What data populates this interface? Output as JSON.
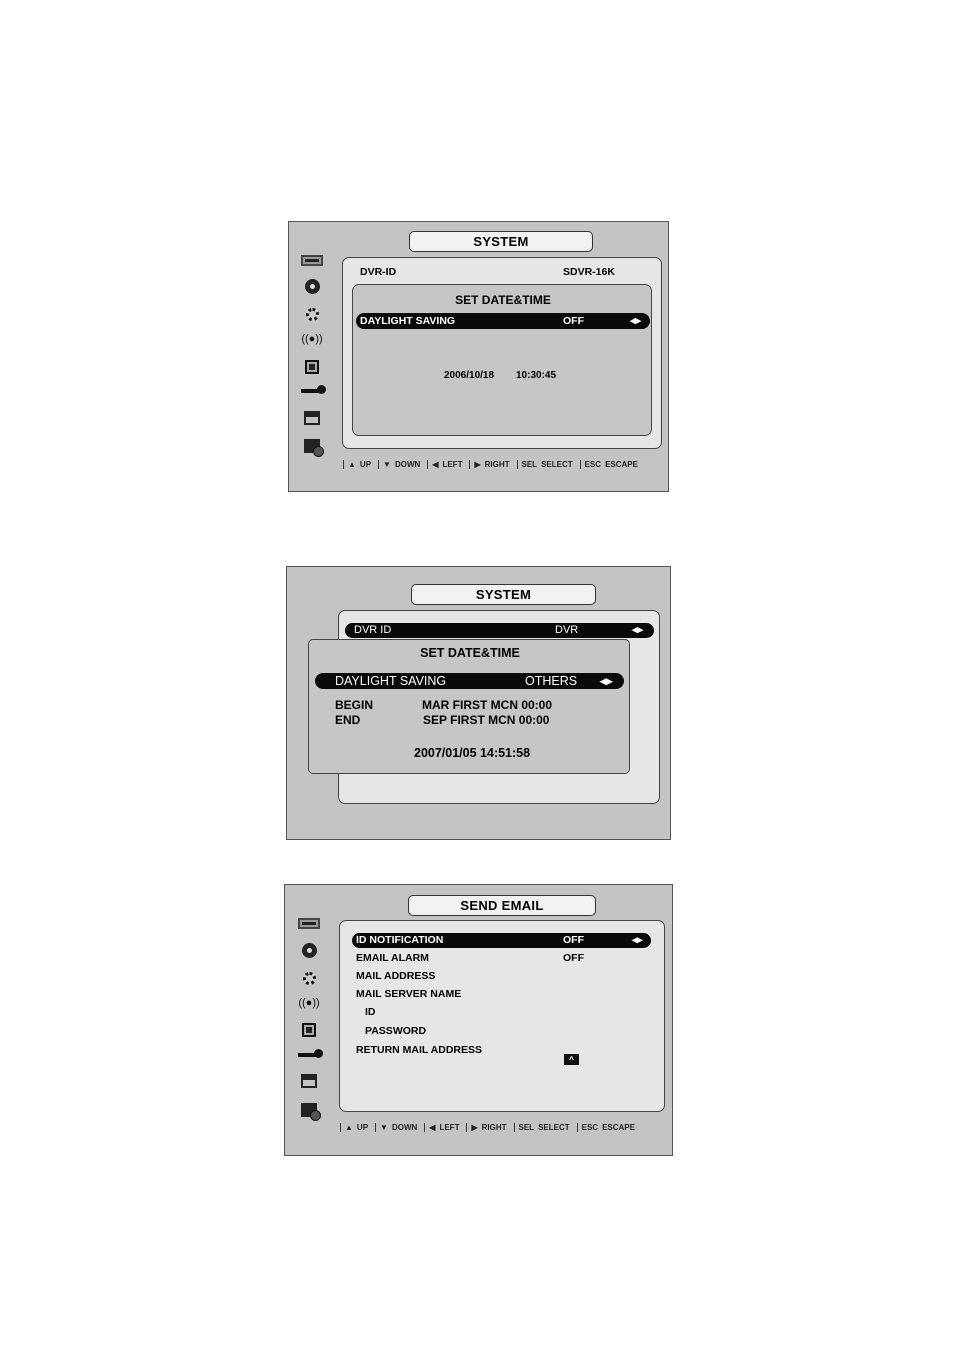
{
  "screen1": {
    "title": "SYSTEM",
    "dvr_id_label": "DVR-ID",
    "dvr_id_value": "SDVR-16K",
    "sub_title": "SET DATE&TIME",
    "daylight_label": "DAYLIGHT SAVING",
    "daylight_value": "OFF",
    "lr_arrows": "◂▸",
    "date": "2006/10/18",
    "time": "10:30:45"
  },
  "screen2": {
    "title": "SYSTEM",
    "dvr_id_label": "DVR ID",
    "dvr_id_value": "DVR",
    "lr_arrows": "◂▸",
    "sub_title": "SET DATE&TIME",
    "daylight_label": "DAYLIGHT SAVING",
    "daylight_value": "OTHERS",
    "begin_label": "BEGIN",
    "begin_value": "MAR FIRST MCN 00:00",
    "end_label": "END",
    "end_value": "SEP FIRST MCN 00:00",
    "datetime": "2007/01/05 14:51:58"
  },
  "screen3": {
    "title": "SEND EMAIL",
    "lr_arrows": "◂▸",
    "up_button": "^",
    "rows": [
      {
        "label": "ID NOTIFICATION",
        "value": "OFF"
      },
      {
        "label": "EMAIL ALARM",
        "value": "OFF"
      },
      {
        "label": "MAIL ADDRESS",
        "value": ""
      },
      {
        "label": "MAIL SERVER NAME",
        "value": ""
      },
      {
        "label": "ID",
        "value": ""
      },
      {
        "label": "PASSWORD",
        "value": ""
      },
      {
        "label": "RETURN MAIL ADDRESS",
        "value": ""
      }
    ]
  },
  "help_bar": {
    "up_glyph": "▲",
    "up": "UP",
    "down_glyph": "▼",
    "down": "DOWN",
    "left_glyph": "◀",
    "left": "LEFT",
    "right_glyph": "▶",
    "right": "RIGHT",
    "sel_key": "SEL",
    "sel": "SELECT",
    "esc_key": "ESC",
    "esc": "ESCAPE"
  },
  "sidebar_icons": [
    "monitor-icon",
    "disk-icon",
    "gear-icon",
    "alarm-icon",
    "computer-icon",
    "key-icon",
    "network-icon",
    "disk-computer-icon"
  ]
}
